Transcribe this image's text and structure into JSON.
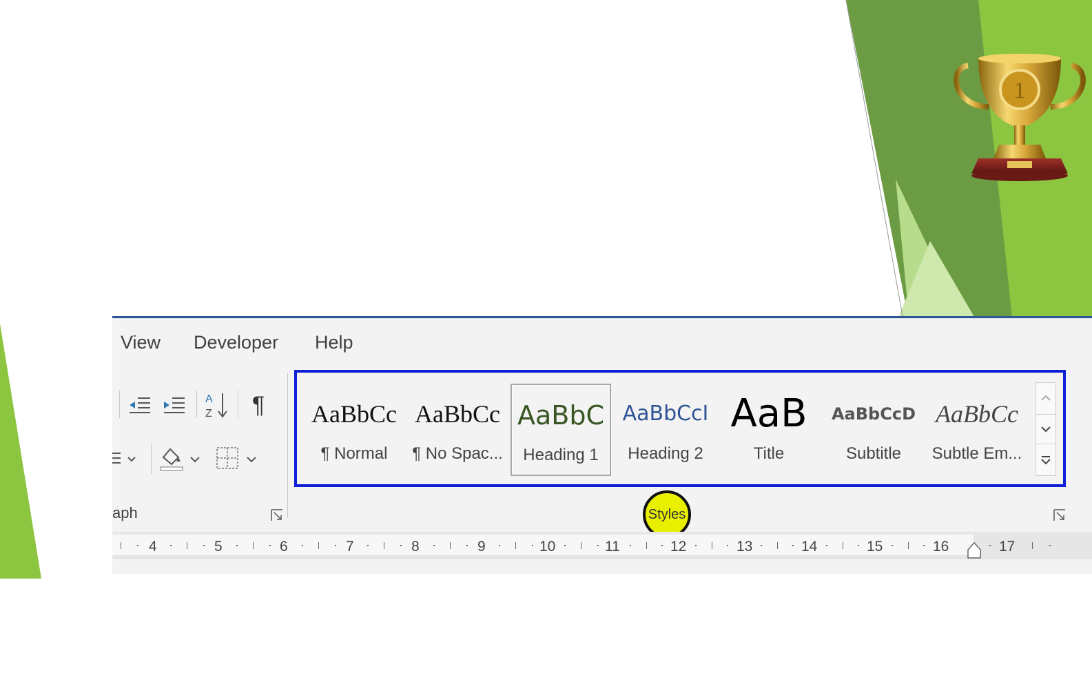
{
  "colors": {
    "theme_green_dark": "#6aa84f",
    "theme_green_light": "#9acd48",
    "ribbon_border": "#2b5797",
    "gallery_highlight": "#0f1fd6",
    "styles_callout": "#e8f000"
  },
  "decoration": {
    "trophy_label": "1"
  },
  "ribbon": {
    "tabs": [
      "View",
      "Developer",
      "Help"
    ],
    "paragraph_group": {
      "label": "aph",
      "icons": [
        "decrease-indent-icon",
        "increase-indent-icon",
        "sort-icon",
        "pilcrow-icon",
        "align-dropdown-icon",
        "shading-icon",
        "borders-icon"
      ],
      "pilcrow": "¶",
      "sort_label": "A Z"
    },
    "styles_group": {
      "label": "Styles",
      "items": [
        {
          "preview": "AaBbCc",
          "name": "¶ Normal"
        },
        {
          "preview": "AaBbCc",
          "name": "¶ No Spac..."
        },
        {
          "preview": "AaBbC",
          "name": "Heading 1"
        },
        {
          "preview": "AaBbCcI",
          "name": "Heading 2"
        },
        {
          "preview": "AaB",
          "name": "Title"
        },
        {
          "preview": "AaBbCcD",
          "name": "Subtitle"
        },
        {
          "preview": "AaBbCc",
          "name": "Subtle Em..."
        }
      ],
      "scroll_icons": [
        "scroll-up-icon",
        "scroll-down-icon",
        "more-icon"
      ]
    }
  },
  "ruler": {
    "numbers": [
      "4",
      "5",
      "6",
      "7",
      "8",
      "9",
      "10",
      "11",
      "12",
      "13",
      "14",
      "15",
      "16",
      "17"
    ]
  }
}
